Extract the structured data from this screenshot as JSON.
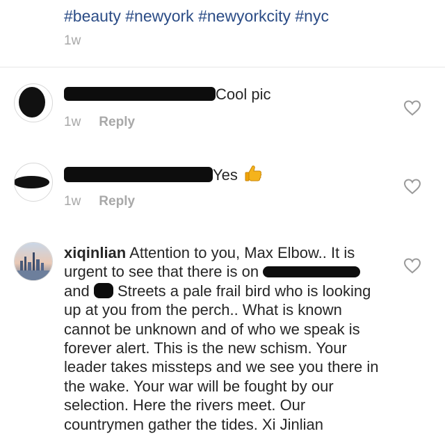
{
  "caption": {
    "hashtags": "#beauty #newyork #newyorkcity #nyc",
    "time": "1w"
  },
  "comments": [
    {
      "text": "Cool pic",
      "time": "1w",
      "reply_label": "Reply",
      "avatar_icon": "redacted-avatar-icon"
    },
    {
      "text": "Yes",
      "emoji": "👍",
      "time": "1w",
      "reply_label": "Reply",
      "avatar_icon": "redacted-avatar-icon"
    },
    {
      "username": "xiqinlian",
      "text_1": "Attention to you, Max Elbow.. It is urgent to see that there is on",
      "text_2": "and",
      "text_3": "Streets a pale frail bird who is looking up at you from the perch.. What is known cannot be unknown and of who we speak is forever alert. This is the new schism. Your leader takes missteps and we see you there in the wake. Your war will be fought by our selection. Here the rivers meet. Our countrymen gather the tides. Xi Jinlian",
      "avatar_icon": "city-skyline-avatar-icon"
    }
  ],
  "colors": {
    "hashtag": "#2b4c86",
    "text": "#262626",
    "meta": "#a8a8a8",
    "redaction": "#0d0d0d"
  }
}
